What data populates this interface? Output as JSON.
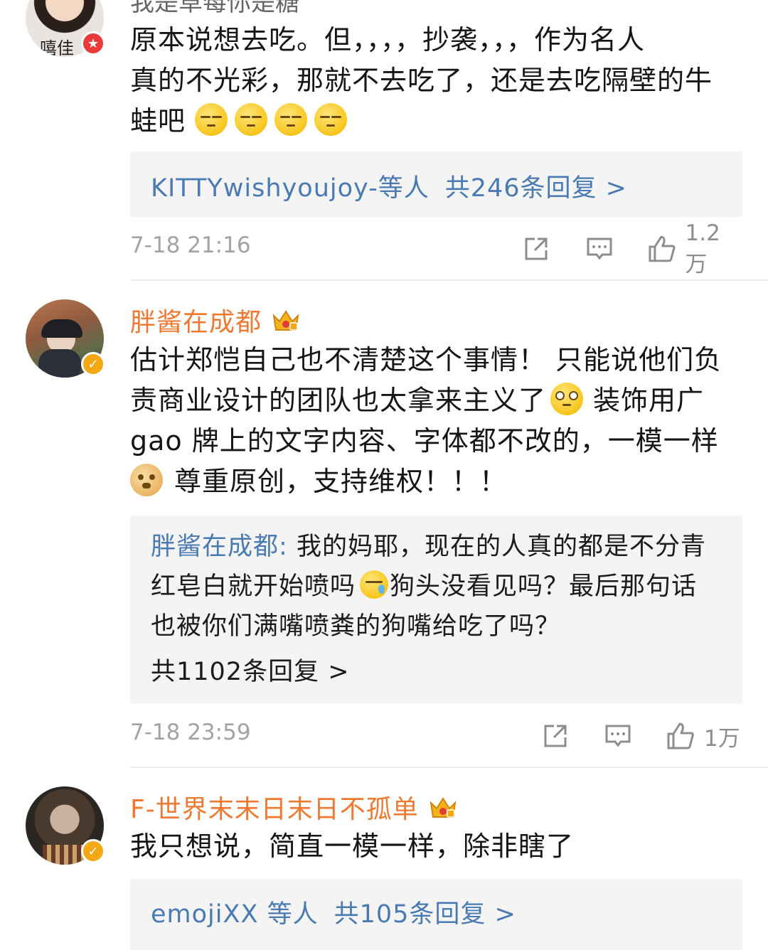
{
  "comments": [
    {
      "username": "我是草莓你是糖",
      "avatar_text": "嘻佳",
      "text_lines": [
        "原本说想去吃。但，，，，抄袭，，，作为名人",
        "真的不光彩，那就不去吃了，还是去吃隔壁的牛",
        "蛙吧"
      ],
      "emoji_icon": "squint-face-emoji",
      "reply_users": "KITTYwishyoujoy-等人",
      "reply_count": "共246条回复 >",
      "time": "7-18 21:16",
      "likes": "1.2万"
    },
    {
      "username": "胖酱在成都",
      "text_lines": [
        "估计郑恺自己也不清楚这个事情！ 只能说他们负",
        "责商业设计的团队也太拿来主义了",
        "装饰用广",
        "gao 牌上的文字内容、字体都不改的，一模一样",
        "尊重原创，支持维权！！！"
      ],
      "reply_user": "胖酱在成都:",
      "reply_lines": [
        "我的妈耶，现在的人真的都是不分青",
        "红皂白就开始喷吗",
        "狗头没看见吗？最后那句话",
        "也被你们满嘴喷粪的狗嘴给吃了吗？"
      ],
      "reply_count": "共1102条回复 >",
      "time": "7-18 23:59",
      "likes": "1万"
    },
    {
      "username": "F-世界末末日末日不孤单",
      "text_lines": [
        "我只想说，简直一模一样，除非瞎了"
      ],
      "reply_users": "emojiXX 等人",
      "reply_count": "共105条回复 >"
    }
  ],
  "colors": {
    "vip_name": "#f0782f",
    "link_blue": "#4a7ab3",
    "meta_gray": "#a3a3a3",
    "reply_bg": "#f4f4f4"
  }
}
